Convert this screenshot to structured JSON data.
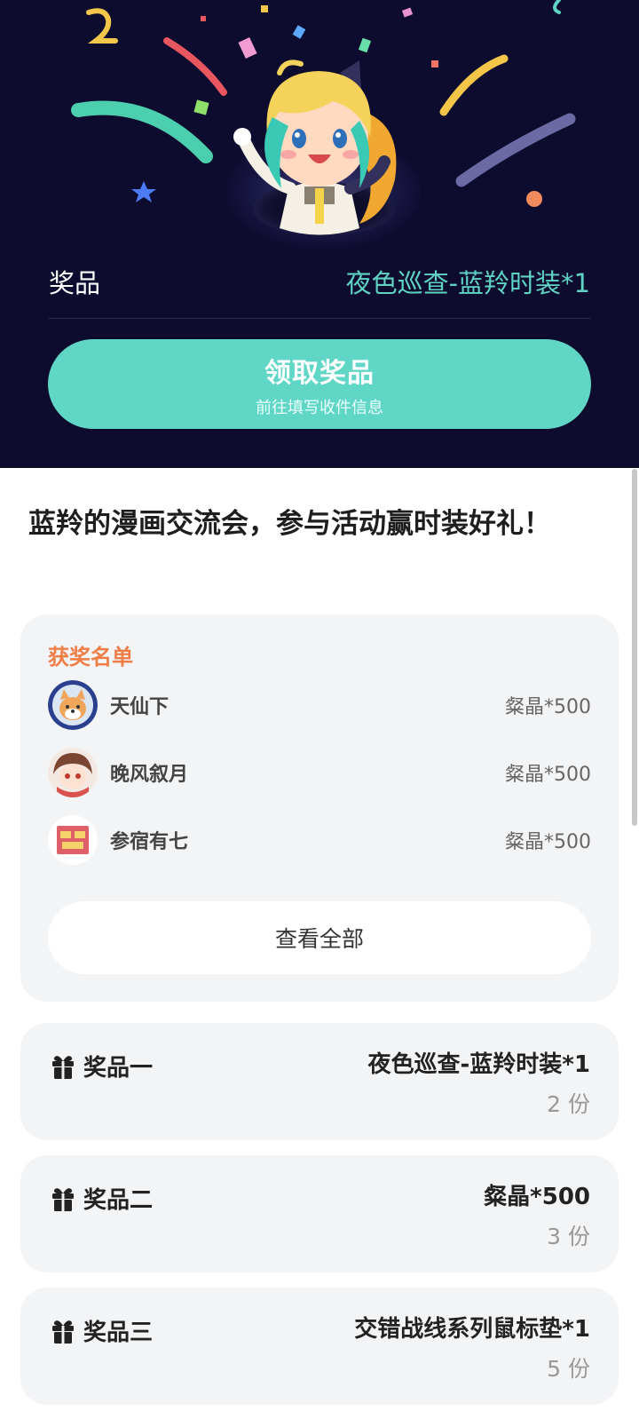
{
  "hero": {
    "prize_label": "奖品",
    "prize_name": "夜色巡查-蓝羚时装*1",
    "claim_button": {
      "title": "领取奖品",
      "subtitle": "前往填写收件信息"
    }
  },
  "event": {
    "title": "蓝羚的漫画交流会，参与活动赢时装好礼！"
  },
  "winners": {
    "title": "获奖名单",
    "list": [
      {
        "name": "天仙下",
        "prize": "粲晶*500"
      },
      {
        "name": "晚风叙月",
        "prize": "粲晶*500"
      },
      {
        "name": "参宿有七",
        "prize": "粲晶*500"
      }
    ],
    "view_all": "查看全部"
  },
  "prizes": [
    {
      "label": "奖品一",
      "name": "夜色巡查-蓝羚时装*1",
      "count": "2 份"
    },
    {
      "label": "奖品二",
      "name": "粲晶*500",
      "count": "3 份"
    },
    {
      "label": "奖品三",
      "name": "交错战线系列鼠标垫*1",
      "count": "5 份"
    }
  ],
  "colors": {
    "hero_bg": "#0d0b2e",
    "accent_teal": "#5fd6c6",
    "winners_title": "#ee7d46",
    "card_bg": "#f3f4f6"
  },
  "icons": {
    "gift": "gift-icon",
    "mascot": "mascot-illustration"
  }
}
